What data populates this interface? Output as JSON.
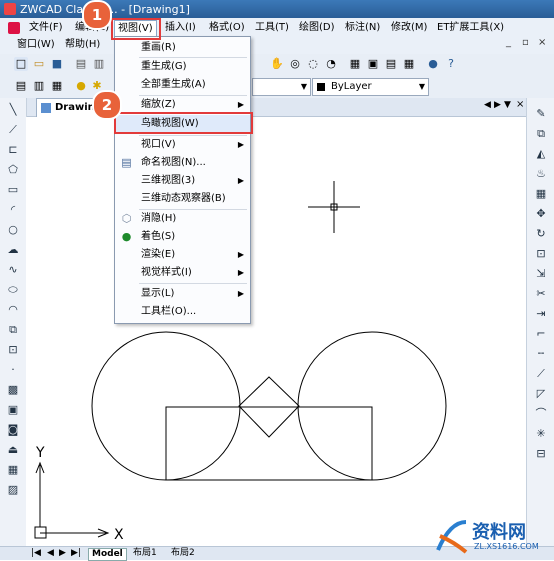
{
  "window": {
    "title": "ZWCAD Classic ... - [Drawing1]"
  },
  "menubar": {
    "row1": [
      "文件(F)",
      "编辑(E)",
      "视图(V)",
      "插入(I)",
      "格式(O)",
      "工具(T)",
      "绘图(D)",
      "标注(N)",
      "修改(M)",
      "ET扩展工具(X)"
    ],
    "row2": [
      "窗口(W)",
      "帮助(H)"
    ],
    "window_controls": [
      "_",
      "▫",
      "×"
    ]
  },
  "toolbar": {
    "layer_select": "ByLayer",
    "layer_swatch_color": "#000000"
  },
  "drawing": {
    "tab_label": "Drawing",
    "axis_x": "X",
    "axis_y": "Y"
  },
  "view_menu": {
    "items": [
      {
        "label": "重画(R)",
        "icon": "",
        "arrow": ""
      },
      {
        "label": "重生成(G)",
        "icon": "",
        "arrow": ""
      },
      {
        "label": "全部重生成(A)",
        "icon": "",
        "arrow": ""
      },
      {
        "label": "缩放(Z)",
        "icon": "",
        "arrow": "▶"
      },
      {
        "label": "鸟瞰视图(W)",
        "icon": "",
        "arrow": ""
      },
      {
        "label": "视口(V)",
        "icon": "",
        "arrow": "▶"
      },
      {
        "label": "命名视图(N)...",
        "icon": "named-view-icon",
        "arrow": ""
      },
      {
        "label": "三维视图(3)",
        "icon": "",
        "arrow": "▶"
      },
      {
        "label": "三维动态观察器(B)",
        "icon": "",
        "arrow": ""
      },
      {
        "label": "消隐(H)",
        "icon": "hide-icon",
        "arrow": ""
      },
      {
        "label": "着色(S)",
        "icon": "shade-icon",
        "arrow": ""
      },
      {
        "label": "渲染(E)",
        "icon": "",
        "arrow": "▶"
      },
      {
        "label": "视觉样式(I)",
        "icon": "",
        "arrow": "▶"
      },
      {
        "label": "显示(L)",
        "icon": "",
        "arrow": "▶"
      },
      {
        "label": "工具栏(O)...",
        "icon": "",
        "arrow": ""
      }
    ]
  },
  "callouts": {
    "step1": "1",
    "step2": "2"
  },
  "layout_tabs": [
    "Model",
    "布局1",
    "布局2"
  ],
  "watermark": {
    "brand": "资料网",
    "url": "ZL.XS1616.COM"
  },
  "colors": {
    "callout": "#e8623a",
    "highlight_box": "#e23a3a",
    "title_bar": "#2a5d96"
  }
}
